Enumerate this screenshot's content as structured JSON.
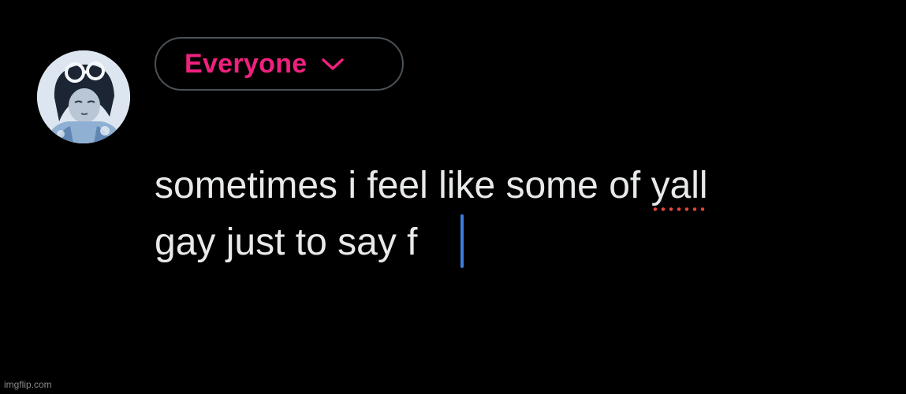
{
  "composer": {
    "audience_label": "Everyone",
    "accent_color": "#f0207f",
    "text_line_1_before": "sometimes i feel like some of ",
    "text_line_1_flagged": "yall",
    "text_line_2": "gay just to say f",
    "caret_color": "#3b7dd8",
    "spellcheck_color": "#e0453a"
  },
  "icons": {
    "audience_dropdown": "chevron-down-icon"
  },
  "watermark": {
    "text": "imgflip.com"
  }
}
